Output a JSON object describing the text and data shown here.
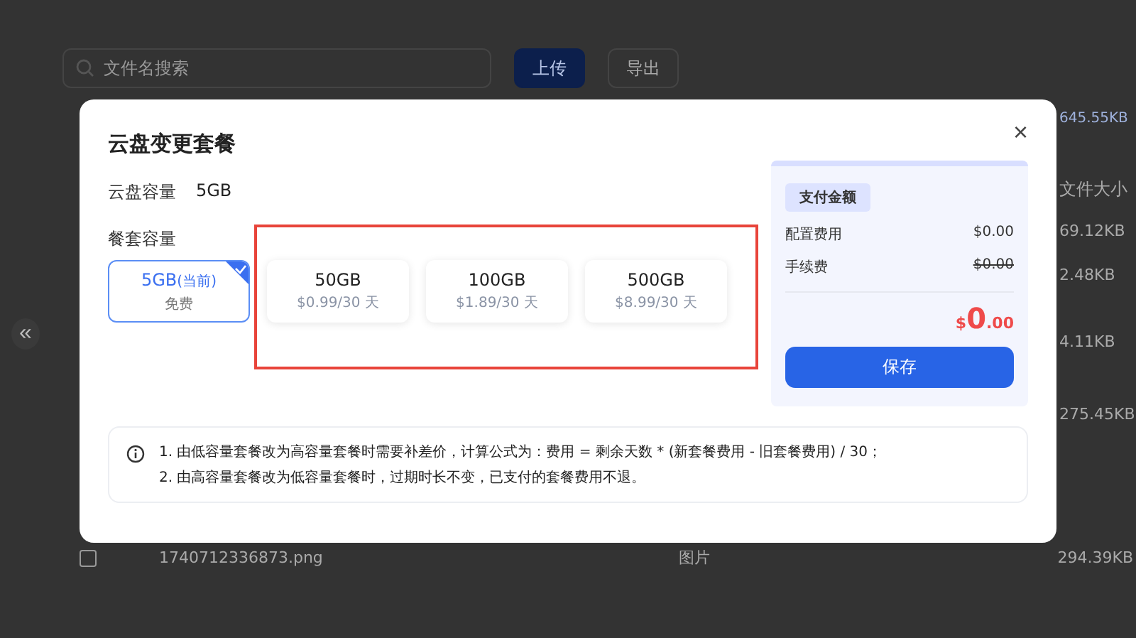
{
  "background": {
    "search": {
      "placeholder": "文件名搜索"
    },
    "buttons": [
      {
        "label": "上传",
        "primary": true
      },
      {
        "label": "导出",
        "primary": false
      }
    ],
    "collapse": "«",
    "summary": "645.55KB",
    "size_header": "文件大小",
    "sizes": [
      "69.12KB",
      "2.48KB",
      "4.11KB",
      "275.45KB"
    ],
    "row": {
      "checked": false,
      "name": "1740712336873.png",
      "type": "图片",
      "size": "294.39KB"
    }
  },
  "dialog": {
    "title": "云盘变更套餐",
    "close": "×",
    "capacity_label": "云盘容量",
    "capacity_value": "5GB",
    "plans_label": "餐套容量",
    "plans": [
      {
        "name": "5GB",
        "tag": "(当前)",
        "price": "免费",
        "selected": true
      },
      {
        "name": "50GB",
        "price": "$0.99/30 天",
        "selected": false
      },
      {
        "name": "100GB",
        "price": "$1.89/30 天",
        "selected": false
      },
      {
        "name": "500GB",
        "price": "$8.99/30 天",
        "selected": false
      }
    ],
    "payment": {
      "badge": "支付金额",
      "lines": [
        {
          "label": "配置费用",
          "value": "$0.00",
          "struck": false
        },
        {
          "label": "手续费",
          "value": "$0.00",
          "struck": true
        }
      ],
      "total_currency": "$",
      "total_int": "0",
      "total_dec": ".00",
      "button": "保存"
    },
    "notes": [
      "1. 由低容量套餐改为高容量套餐时需要补差价，计算公式为：费用 = 剩余天数 * (新套餐费用 - 旧套餐费用) / 30；",
      "2. 由高容量套餐改为低容量套餐时，过期时长不变，已支付的套餐费用不退。"
    ]
  }
}
